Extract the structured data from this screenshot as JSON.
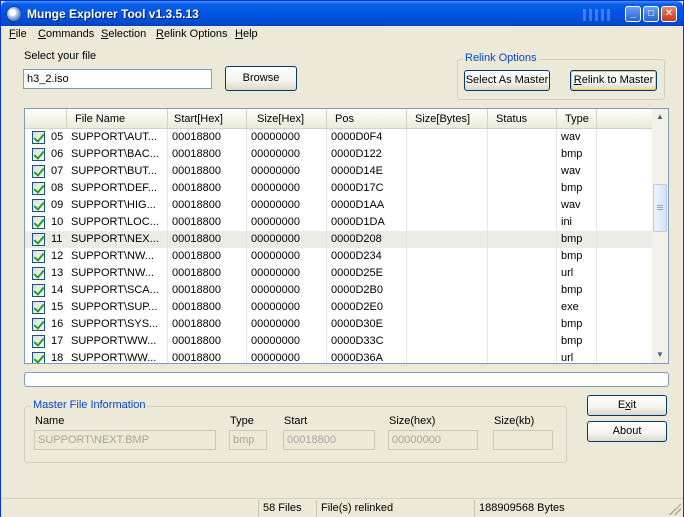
{
  "window": {
    "title": "Munge Explorer Tool v1.3.5.13",
    "minimize_glyph": "_",
    "maximize_glyph": "□",
    "close_glyph": "✕"
  },
  "menu": {
    "items": [
      "File",
      "Commands",
      "Selection",
      "Relink Options",
      "Help"
    ]
  },
  "file_select": {
    "label": "Select your file",
    "value": "h3_2.iso",
    "browse_label": "Browse"
  },
  "relink_options": {
    "legend": "Relink Options",
    "select_as_master_label": "Select As Master",
    "relink_to_master_label": "Relink to Master"
  },
  "list": {
    "columns": [
      "File Name",
      "Start[Hex]",
      "Size[Hex]",
      "Pos",
      "Size[Bytes]",
      "Status",
      "Type"
    ],
    "rows": [
      {
        "num": "05",
        "name": "SUPPORT\\AUT...",
        "start": "00018800",
        "size": "00000000",
        "pos": "0000D0F4",
        "bytes": "",
        "status": "",
        "type": "wav",
        "checked": true
      },
      {
        "num": "06",
        "name": "SUPPORT\\BAC...",
        "start": "00018800",
        "size": "00000000",
        "pos": "0000D122",
        "bytes": "",
        "status": "",
        "type": "bmp",
        "checked": true
      },
      {
        "num": "07",
        "name": "SUPPORT\\BUT...",
        "start": "00018800",
        "size": "00000000",
        "pos": "0000D14E",
        "bytes": "",
        "status": "",
        "type": "wav",
        "checked": true
      },
      {
        "num": "08",
        "name": "SUPPORT\\DEF...",
        "start": "00018800",
        "size": "00000000",
        "pos": "0000D17C",
        "bytes": "",
        "status": "",
        "type": "bmp",
        "checked": true
      },
      {
        "num": "09",
        "name": "SUPPORT\\HIG...",
        "start": "00018800",
        "size": "00000000",
        "pos": "0000D1AA",
        "bytes": "",
        "status": "",
        "type": "wav",
        "checked": true
      },
      {
        "num": "10",
        "name": "SUPPORT\\LOC...",
        "start": "00018800",
        "size": "00000000",
        "pos": "0000D1DA",
        "bytes": "",
        "status": "",
        "type": "ini",
        "checked": true
      },
      {
        "num": "11",
        "name": "SUPPORT\\NEX...",
        "start": "00018800",
        "size": "00000000",
        "pos": "0000D208",
        "bytes": "",
        "status": "",
        "type": "bmp",
        "checked": true,
        "selected": true
      },
      {
        "num": "12",
        "name": "SUPPORT\\NW...",
        "start": "00018800",
        "size": "00000000",
        "pos": "0000D234",
        "bytes": "",
        "status": "",
        "type": "bmp",
        "checked": true
      },
      {
        "num": "13",
        "name": "SUPPORT\\NW...",
        "start": "00018800",
        "size": "00000000",
        "pos": "0000D25E",
        "bytes": "",
        "status": "",
        "type": "url",
        "checked": true
      },
      {
        "num": "14",
        "name": "SUPPORT\\SCA...",
        "start": "00018800",
        "size": "00000000",
        "pos": "0000D2B0",
        "bytes": "",
        "status": "",
        "type": "bmp",
        "checked": true
      },
      {
        "num": "15",
        "name": "SUPPORT\\SUP...",
        "start": "00018800",
        "size": "00000000",
        "pos": "0000D2E0",
        "bytes": "",
        "status": "",
        "type": "exe",
        "checked": true
      },
      {
        "num": "16",
        "name": "SUPPORT\\SYS...",
        "start": "00018800",
        "size": "00000000",
        "pos": "0000D30E",
        "bytes": "",
        "status": "",
        "type": "bmp",
        "checked": true
      },
      {
        "num": "17",
        "name": "SUPPORT\\WW...",
        "start": "00018800",
        "size": "00000000",
        "pos": "0000D33C",
        "bytes": "",
        "status": "",
        "type": "bmp",
        "checked": true
      },
      {
        "num": "18",
        "name": "SUPPORT\\WW...",
        "start": "00018800",
        "size": "00000000",
        "pos": "0000D36A",
        "bytes": "",
        "status": "",
        "type": "url",
        "checked": true
      }
    ],
    "scroll_up_glyph": "▲",
    "scroll_down_glyph": "▼"
  },
  "progress": {
    "value": 0
  },
  "master_info": {
    "legend": "Master File Information",
    "name_label": "Name",
    "name_value": "SUPPORT\\NEXT.BMP",
    "type_label": "Type",
    "type_value": "bmp",
    "start_label": "Start",
    "start_value": "00018800",
    "sizehex_label": "Size(hex)",
    "sizehex_value": "00000000",
    "sizekb_label": "Size(kb)",
    "sizekb_value": ""
  },
  "buttons": {
    "exit_label": "Exit",
    "about_label": "About"
  },
  "statusbar": {
    "panel1": "",
    "files": "58 Files",
    "relinked": "File(s) relinked",
    "bytes": "188909568 Bytes"
  },
  "colors": {
    "titlebar": "#0054e3",
    "window_bg": "#ece9d8",
    "group_legend": "#0046d5",
    "checkmark": "#21a121"
  }
}
